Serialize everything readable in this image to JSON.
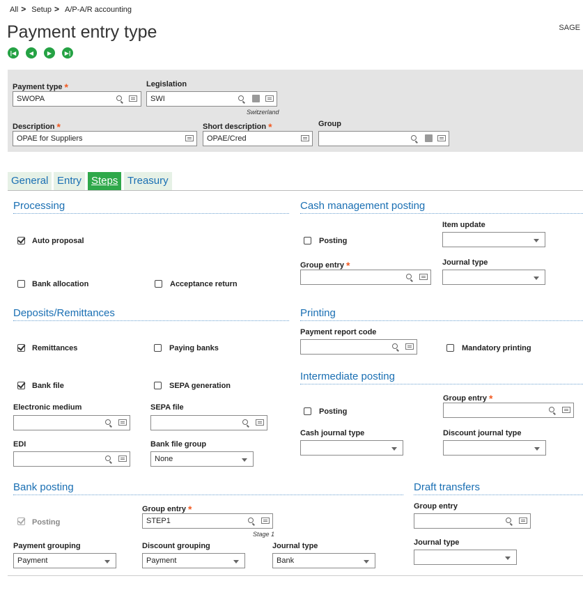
{
  "breadcrumb": {
    "items": [
      "All",
      "Setup",
      "A/P-A/R accounting"
    ],
    "separator": ">"
  },
  "page_title": "Payment entry type",
  "app_name": "SAGE",
  "nav_icons": [
    "first-record-icon",
    "previous-record-icon",
    "next-record-icon",
    "last-record-icon"
  ],
  "header": {
    "payment_type": {
      "label": "Payment type",
      "value": "SWOPA"
    },
    "legislation": {
      "label": "Legislation",
      "value": "SWI",
      "caption": "Switzerland"
    },
    "description": {
      "label": "Description",
      "value": "OPAE for Suppliers"
    },
    "short_description": {
      "label": "Short description",
      "value": "OPAE/Cred"
    },
    "group": {
      "label": "Group",
      "value": ""
    }
  },
  "tabs": [
    "General",
    "Entry",
    "Steps",
    "Treasury"
  ],
  "active_tab": "Steps",
  "processing": {
    "title": "Processing",
    "auto_proposal": {
      "label": "Auto proposal",
      "checked": true
    },
    "bank_allocation": {
      "label": "Bank allocation",
      "checked": false
    },
    "acceptance_return": {
      "label": "Acceptance return",
      "checked": false
    }
  },
  "cash_management": {
    "title": "Cash management posting",
    "posting": {
      "label": "Posting",
      "checked": false
    },
    "item_update": {
      "label": "Item update",
      "value": ""
    },
    "group_entry": {
      "label": "Group entry",
      "value": ""
    },
    "journal_type": {
      "label": "Journal type",
      "value": ""
    }
  },
  "deposits": {
    "title": "Deposits/Remittances",
    "remittances": {
      "label": "Remittances",
      "checked": true
    },
    "paying_banks": {
      "label": "Paying banks",
      "checked": false
    },
    "bank_file": {
      "label": "Bank file",
      "checked": true
    },
    "sepa_generation": {
      "label": "SEPA generation",
      "checked": false
    },
    "electronic_medium": {
      "label": "Electronic medium",
      "value": ""
    },
    "sepa_file": {
      "label": "SEPA file",
      "value": ""
    },
    "edi": {
      "label": "EDI",
      "value": ""
    },
    "bank_file_group": {
      "label": "Bank file group",
      "value": "None"
    }
  },
  "printing": {
    "title": "Printing",
    "payment_report_code": {
      "label": "Payment report code",
      "value": ""
    },
    "mandatory_printing": {
      "label": "Mandatory printing",
      "checked": false
    }
  },
  "intermediate": {
    "title": "Intermediate posting",
    "posting": {
      "label": "Posting",
      "checked": false
    },
    "group_entry": {
      "label": "Group entry",
      "value": ""
    },
    "cash_journal_type": {
      "label": "Cash journal type",
      "value": ""
    },
    "discount_journal_type": {
      "label": "Discount journal type",
      "value": ""
    }
  },
  "bank_posting": {
    "title": "Bank posting",
    "posting": {
      "label": "Posting",
      "checked": true,
      "disabled": true
    },
    "group_entry": {
      "label": "Group entry",
      "value": "STEP1",
      "caption": "Stage 1"
    },
    "payment_grouping": {
      "label": "Payment grouping",
      "value": "Payment"
    },
    "discount_grouping": {
      "label": "Discount grouping",
      "value": "Payment"
    },
    "journal_type": {
      "label": "Journal type",
      "value": "Bank"
    }
  },
  "draft_transfers": {
    "title": "Draft transfers",
    "group_entry": {
      "label": "Group entry",
      "value": ""
    },
    "journal_type": {
      "label": "Journal type",
      "value": ""
    }
  }
}
